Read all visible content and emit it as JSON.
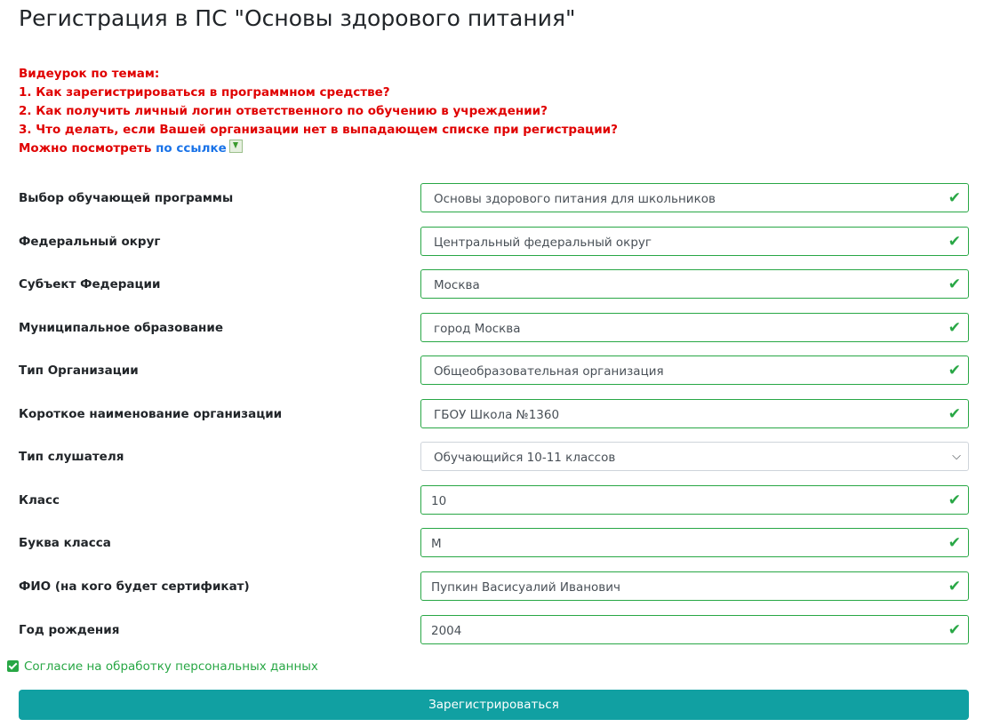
{
  "page": {
    "title": "Регистрация в ПС \"Основы здорового питания\""
  },
  "notice": {
    "line1": "Видеурок по темам:",
    "line2": "1. Как зарегистрироваться в программном средстве?",
    "line3": "2. Как получить личный логин ответственного по обучению в учреждении?",
    "line4": "3. Что делать, если Вашей организации нет в выпадающем списке при регистрации?",
    "line5_prefix": "Можно посмотреть ",
    "link_text": "по ссылке",
    "link_icon": "download-icon"
  },
  "form": {
    "fields": [
      {
        "label": "Выбор обучающей программы",
        "value": "Основы здорового питания для школьников",
        "type": "select",
        "status": "valid"
      },
      {
        "label": "Федеральный округ",
        "value": "Центральный федеральный округ",
        "type": "select",
        "status": "valid"
      },
      {
        "label": "Субъект Федерации",
        "value": "Москва",
        "type": "select",
        "status": "valid"
      },
      {
        "label": "Муниципальное образование",
        "value": "город Москва",
        "type": "select",
        "status": "valid"
      },
      {
        "label": "Тип Организации",
        "value": "Общеобразовательная организация",
        "type": "select",
        "status": "valid"
      },
      {
        "label": "Короткое наименование организации",
        "value": "ГБОУ Школа №1360",
        "type": "select",
        "status": "valid"
      },
      {
        "label": "Тип слушателя",
        "value": "Обучающийся 10-11 классов",
        "type": "select",
        "status": "none"
      },
      {
        "label": "Класс",
        "value": "10",
        "type": "text",
        "status": "valid"
      },
      {
        "label": "Буква класса",
        "value": "М",
        "type": "text",
        "status": "valid"
      },
      {
        "label": "ФИО (на кого будет сертификат)",
        "value": "Пупкин Васисуалий Иванович",
        "type": "text",
        "status": "valid"
      },
      {
        "label": "Год рождения",
        "value": "2004",
        "type": "text",
        "status": "valid"
      }
    ],
    "consent_label": "Согласие на обработку персональных данных",
    "consent_checked": true,
    "submit_label": "Зарегистрироваться"
  },
  "colors": {
    "valid": "#28a745",
    "notice": "#e00000",
    "link": "#1a73e8",
    "button": "#11a0a2"
  }
}
